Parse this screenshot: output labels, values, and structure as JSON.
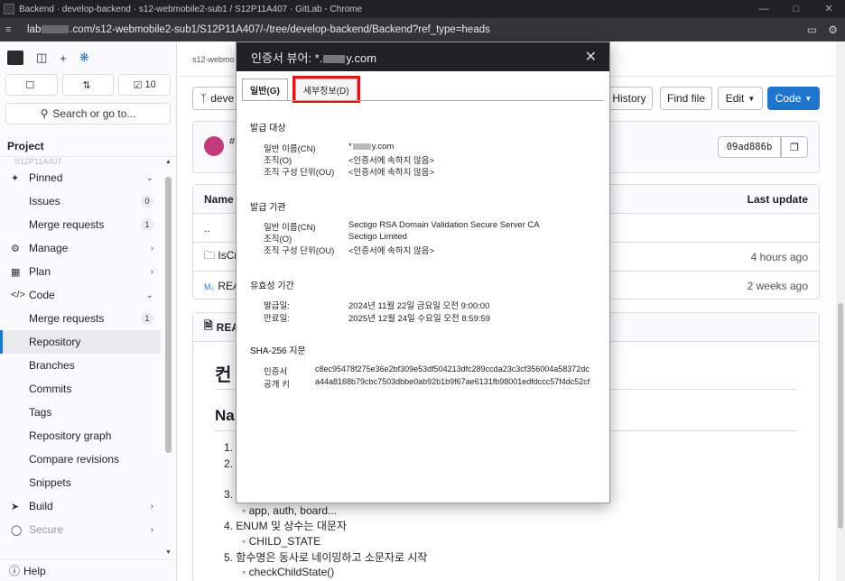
{
  "window": {
    "title": "Backend · develop-backend · s12-webmobile2-sub1 / S12P11A407 · GitLab - Chrome",
    "url_prefix": "lab",
    "url_suffix": ".com/s12-webmobile2-sub1/S12P11A407/-/tree/develop-backend/Backend?ref_type=heads"
  },
  "sidebar": {
    "todo_count": "",
    "mr_count": "",
    "issues_badge_count": "10",
    "search_label": "Search or go to...",
    "section_label": "Project",
    "ghost_label": "S12P11A407",
    "items": [
      {
        "label": "Pinned"
      },
      {
        "label": "Issues",
        "badge": "0"
      },
      {
        "label": "Merge requests",
        "badge": "1"
      },
      {
        "label": "Manage"
      },
      {
        "label": "Plan"
      },
      {
        "label": "Code"
      },
      {
        "label": "Merge requests",
        "badge": "1"
      },
      {
        "label": "Repository"
      },
      {
        "label": "Branches"
      },
      {
        "label": "Commits"
      },
      {
        "label": "Tags"
      },
      {
        "label": "Repository graph"
      },
      {
        "label": "Compare revisions"
      },
      {
        "label": "Snippets"
      },
      {
        "label": "Build"
      },
      {
        "label": "Secure"
      }
    ],
    "help_label": "Help"
  },
  "main": {
    "breadcrumb": "s12-webmo",
    "branch_label": "deve",
    "history_label": "History",
    "find_file_label": "Find file",
    "edit_label": "Edit",
    "code_label": "Code",
    "commit_sha": "09ad886b",
    "commit_hash_fragment": "#",
    "table": {
      "name_header": "Name",
      "last_update_header": "Last update",
      "rows": [
        {
          "name": "..",
          "updated": ""
        },
        {
          "name": "IsCr",
          "updated": "4 hours ago"
        },
        {
          "name": "REA",
          "updated": "2 weeks ago"
        }
      ]
    },
    "readme": {
      "header": "REA",
      "h1": "컨",
      "h2": "Nar",
      "items": [
        "1.",
        "2.",
        "3.",
        "app, auth, board...",
        "4. ENUM 및 상수는 대문자",
        "CHILD_STATE",
        "5. 함수명은 동사로 네이밍하고 소문자로 시작",
        "checkChildState()"
      ]
    }
  },
  "dialog": {
    "title_prefix": "인증서 뷰어: *.",
    "title_suffix": "y.com",
    "close": "✕",
    "tabs": {
      "general": "일반(G)",
      "details": "세부정보(D)"
    },
    "subject": {
      "heading": "발급 대상",
      "rows": [
        {
          "k": "일반 이름(CN)",
          "v_prefix": "*",
          "v_suffix": "y.com"
        },
        {
          "k": "조직(O)",
          "v": "<인증서에 속하지 않음>"
        },
        {
          "k": "조직 구성 단위(OU)",
          "v": "<인증서에 속하지 않음>"
        }
      ]
    },
    "issuer": {
      "heading": "발급 기관",
      "rows": [
        {
          "k": "일반 이름(CN)",
          "v": "Sectigo RSA Domain Validation Secure Server CA"
        },
        {
          "k": "조직(O)",
          "v": "Sectigo Limited"
        },
        {
          "k": "조직 구성 단위(OU)",
          "v": "<인증서에 속하지 않음>"
        }
      ]
    },
    "validity": {
      "heading": "유효성 기간",
      "rows": [
        {
          "k": "발급일:",
          "v": "2024년 11월 22일 금요일 오전 9:00:00"
        },
        {
          "k": "만료일:",
          "v": "2025년 12월 24일 수요일 오전 8:59:59"
        }
      ]
    },
    "fingerprint": {
      "heading": "SHA-256 지문",
      "rows": [
        {
          "k": "인증서",
          "v": "c8ec95478f275e36e2bf309e53df504213dfc289ccda23c3cf356004a58372dc"
        },
        {
          "k": "공개 키",
          "v": "a44a8168b79cbc7503dbbe0ab92b1b9f67ae6131fb98001edfdccc57f4dc52cf"
        }
      ]
    }
  },
  "colors": {
    "accent": "#1f75cb",
    "highlight": "#d21b1b",
    "dark_chrome": "#202124"
  }
}
